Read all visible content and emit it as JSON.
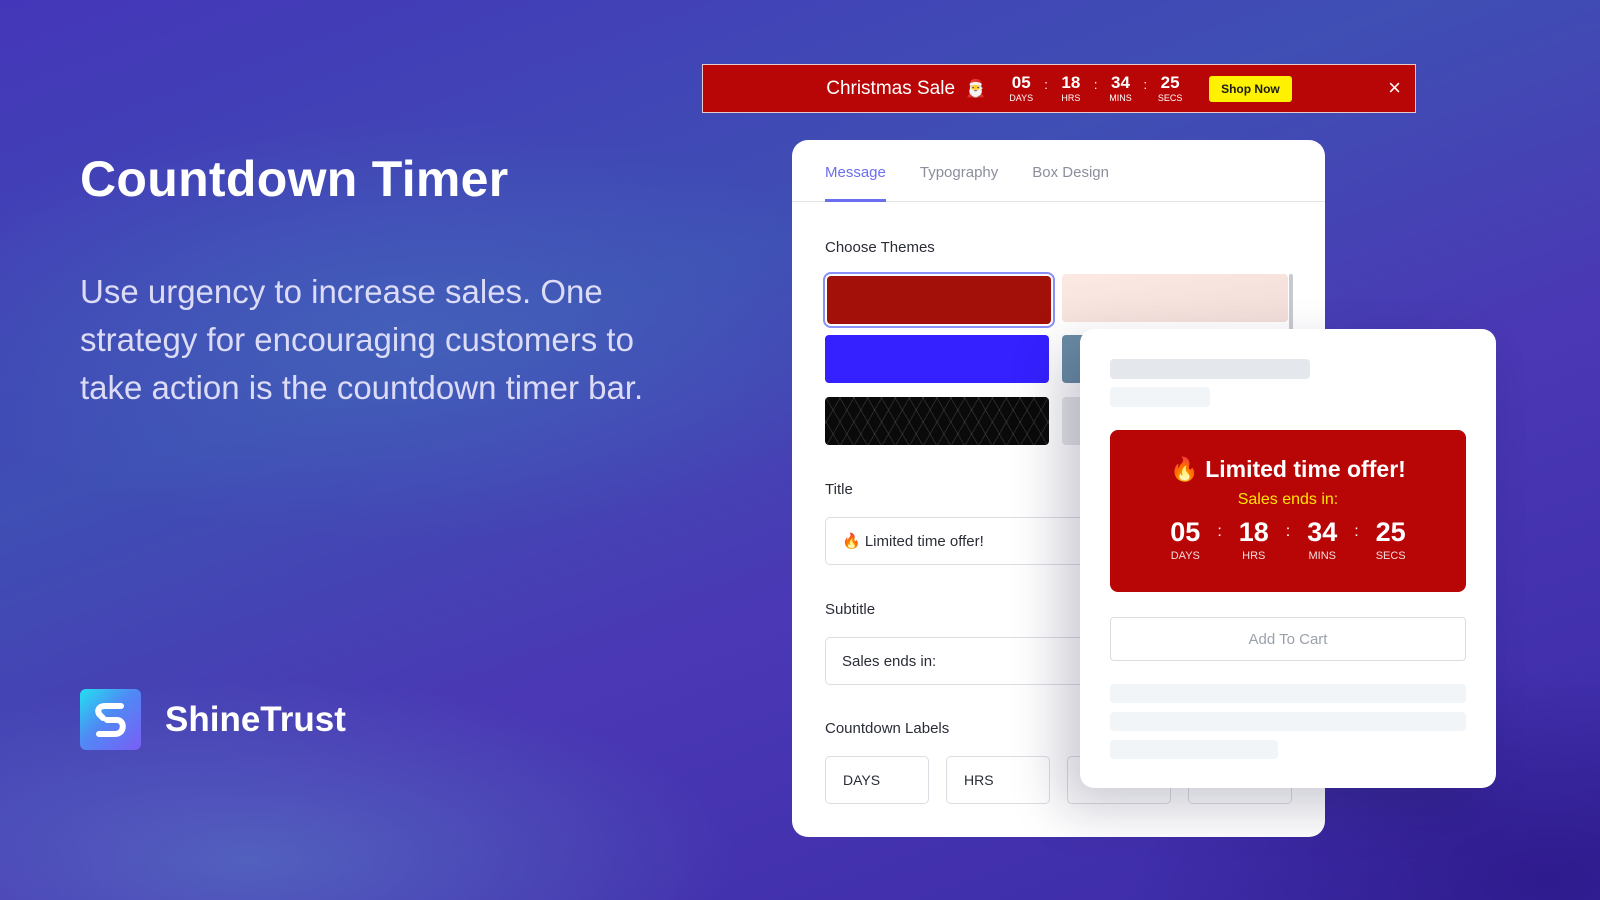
{
  "hero": {
    "title": "Countdown Timer",
    "description": "Use urgency to increase sales. One strategy for encouraging customers to take action is the countdown timer bar."
  },
  "brand": {
    "name": "ShineTrust",
    "logo_icon": "shinetrust-s-logo"
  },
  "banner": {
    "title": "Christmas Sale",
    "emoji": "🎅",
    "background_color": "#b80606",
    "countdown": [
      {
        "value": "05",
        "label": "DAYS"
      },
      {
        "value": "18",
        "label": "HRS"
      },
      {
        "value": "34",
        "label": "MINS"
      },
      {
        "value": "25",
        "label": "SECS"
      }
    ],
    "separator": ":",
    "cta_label": "Shop Now",
    "cta_color": "#fff200",
    "close_icon": "×"
  },
  "settings": {
    "tabs": [
      {
        "label": "Message",
        "active": true
      },
      {
        "label": "Typography",
        "active": false
      },
      {
        "label": "Box Design",
        "active": false
      }
    ],
    "accent_color": "#6b6ef0",
    "choose_themes_label": "Choose Themes",
    "themes": [
      {
        "name": "red",
        "color": "#a3100a",
        "selected": true
      },
      {
        "name": "blush",
        "color": "#fbe6e0",
        "selected": false
      },
      {
        "name": "blue",
        "color": "#3520ff",
        "selected": false
      },
      {
        "name": "slate",
        "color": "#6a8ca5",
        "selected": false
      },
      {
        "name": "black-pattern",
        "color": "#0a0a0a",
        "selected": false
      },
      {
        "name": "gray",
        "color": "#e5e5e7",
        "selected": false
      }
    ],
    "title_label": "Title",
    "title_value": "🔥 Limited time offer!",
    "subtitle_label": "Subtitle",
    "subtitle_value": "Sales ends in:",
    "countdown_labels_label": "Countdown Labels",
    "countdown_labels": [
      "DAYS",
      "HRS",
      "",
      ""
    ]
  },
  "preview": {
    "offer_title": "🔥 Limited time offer!",
    "offer_subtitle": "Sales ends in:",
    "countdown": [
      {
        "value": "05",
        "label": "DAYS"
      },
      {
        "value": "18",
        "label": "HRS"
      },
      {
        "value": "34",
        "label": "MINS"
      },
      {
        "value": "25",
        "label": "SECS"
      }
    ],
    "separator": ":",
    "add_to_cart_label": "Add To Cart"
  }
}
